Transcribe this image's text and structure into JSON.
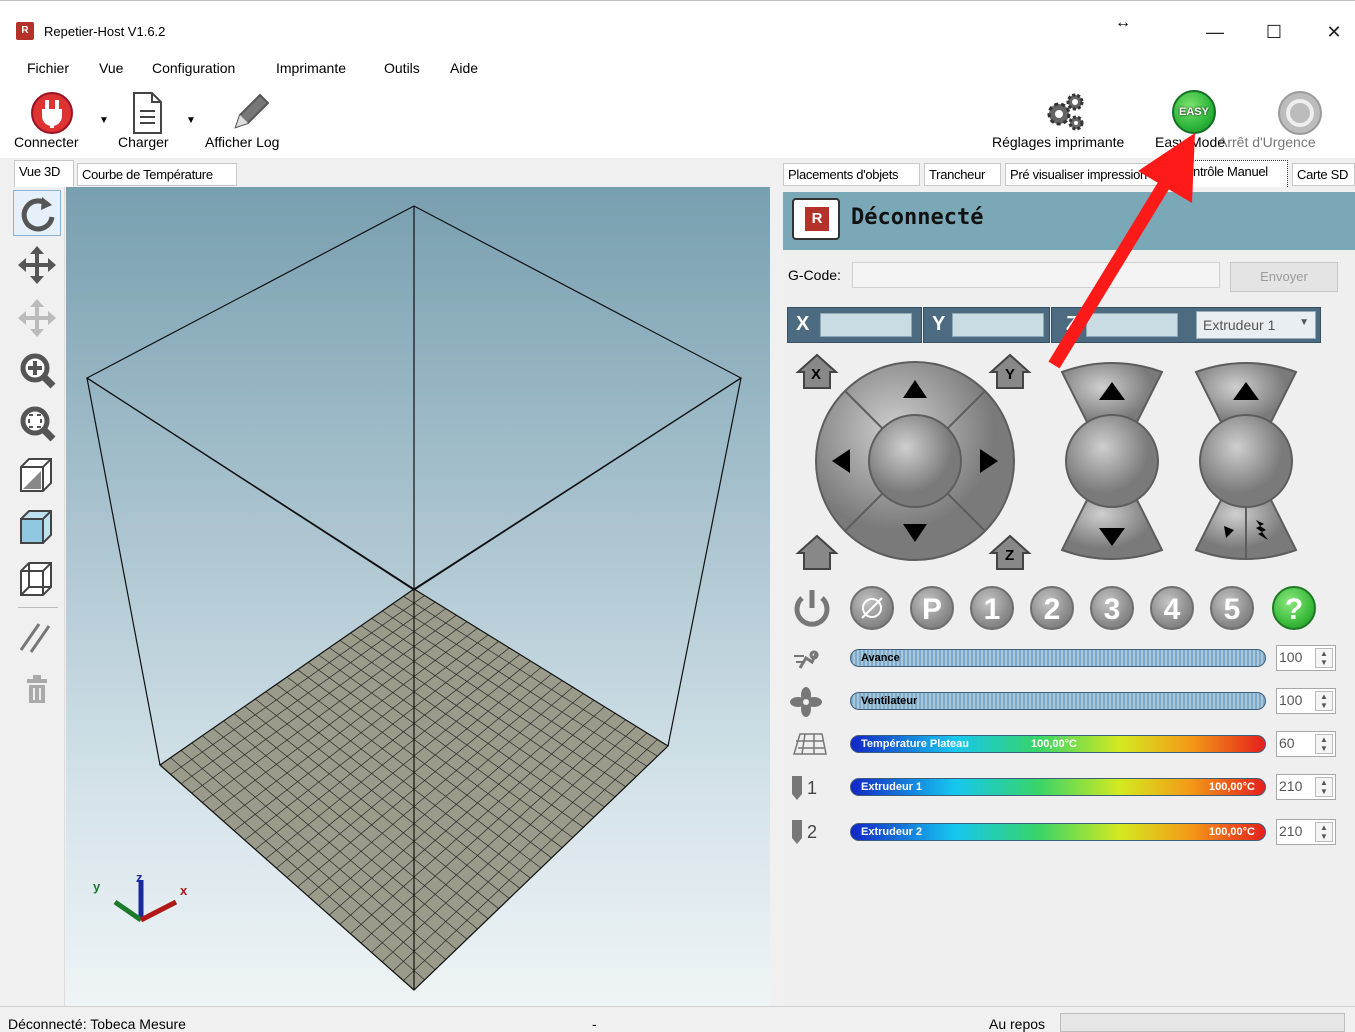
{
  "window": {
    "title": "Repetier-Host V1.6.2",
    "logo_text": "R",
    "resize_glyph": "↔",
    "min_glyph": "—",
    "max_glyph": "☐",
    "close_glyph": "✕"
  },
  "menu": [
    "Fichier",
    "Vue",
    "Configuration",
    "Imprimante",
    "Outils",
    "Aide"
  ],
  "toolbar": {
    "connect_label": "Connecter",
    "load_label": "Charger",
    "log_label": "Afficher Log",
    "printer_settings_label": "Réglages imprimante",
    "easy_mode_label": "Easy Mode",
    "easy_badge": "EASY",
    "emergency_label": "Arrêt d'Urgence"
  },
  "left_tabs": [
    "Vue 3D",
    "Courbe de Température"
  ],
  "right_tabs": [
    "Placements d'objets",
    "Trancheur",
    "Pré visualiser impression",
    "Contrôle Manuel",
    "Carte SD"
  ],
  "manual": {
    "status": "Déconnecté",
    "logo_text": "R",
    "gcode_label": "G-Code:",
    "gcode_value": "",
    "send_label": "Envoyer",
    "x_label": "X",
    "y_label": "Y",
    "z_label": "Z",
    "x_value": "",
    "y_value": "",
    "z_value": "",
    "extruder_select": "Extrudeur 1",
    "home_x": "X",
    "home_y": "Y",
    "home_z": "Z",
    "num_buttons": [
      "P",
      "1",
      "2",
      "3",
      "4",
      "5",
      "?"
    ],
    "speed": {
      "label": "Avance",
      "value": "100"
    },
    "fan": {
      "label": "Ventilateur",
      "value": "100"
    },
    "bed": {
      "label": "Température Plateau",
      "reading": "100,00°C",
      "target": "60"
    },
    "ext1": {
      "label": "Extrudeur 1",
      "reading": "100,00°C",
      "target": "210",
      "num": "1"
    },
    "ext2": {
      "label": "Extrudeur 2",
      "reading": "100,00°C",
      "target": "210",
      "num": "2"
    }
  },
  "status": {
    "left": "Déconnecté: Tobeca Mesure",
    "middle": "-",
    "right": "Au repos"
  },
  "colors": {
    "titlebar": "#ffffff",
    "panel": "#7ba8b7",
    "arrow": "#ff1a1a",
    "easy_green": "#2db53a"
  }
}
